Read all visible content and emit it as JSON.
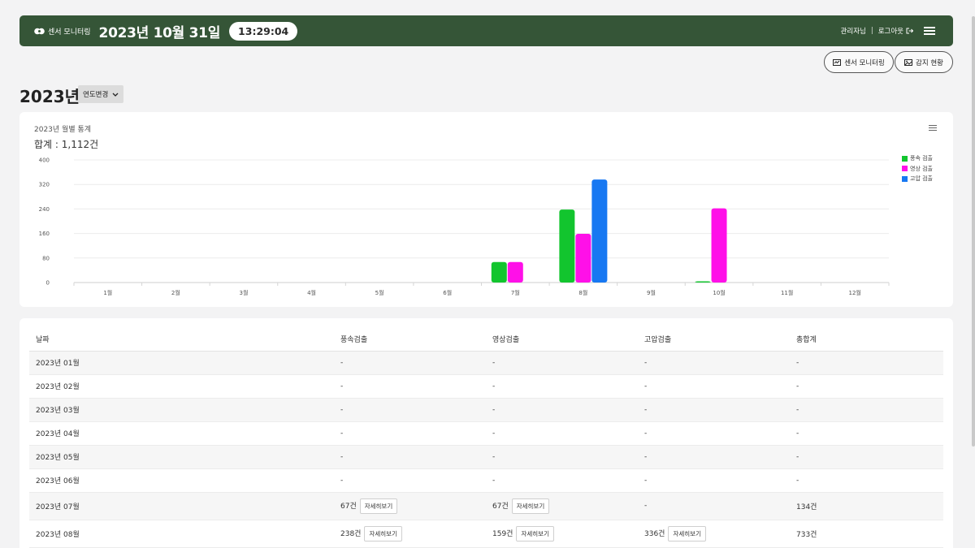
{
  "header": {
    "logo_label": "센서 모니터링",
    "date": "2023년 10월 31일",
    "time": "13:29:04",
    "user": "관리자님",
    "separator": "|",
    "logout": "로그아웃"
  },
  "nav": {
    "sensor_monitoring": "센서 모니터링",
    "detection_status": "감지 현황"
  },
  "year": {
    "title": "2023년",
    "change_label": "연도변경"
  },
  "chart_data": {
    "type": "bar",
    "title": "2023년 월별 통계",
    "total_label": "합계 : 1,112건",
    "categories": [
      "1월",
      "2월",
      "3월",
      "4월",
      "5월",
      "6월",
      "7월",
      "8월",
      "9월",
      "10월",
      "11월",
      "12월"
    ],
    "yticks": [
      "0",
      "80",
      "160",
      "240",
      "320",
      "400"
    ],
    "ylim": [
      0,
      400
    ],
    "grid": true,
    "legend_position": "top-right",
    "series": [
      {
        "name": "풍속 검출",
        "color": "#12c52e",
        "values": [
          0,
          0,
          0,
          0,
          0,
          0,
          67,
          238,
          0,
          4,
          0,
          0
        ]
      },
      {
        "name": "영상 검출",
        "color": "#ff10e8",
        "values": [
          0,
          0,
          0,
          0,
          0,
          0,
          67,
          159,
          0,
          242,
          0,
          0
        ]
      },
      {
        "name": "고압 검출",
        "color": "#1778f2",
        "values": [
          0,
          0,
          0,
          0,
          0,
          0,
          0,
          336,
          0,
          0,
          0,
          0
        ]
      }
    ]
  },
  "table": {
    "headers": [
      "날짜",
      "풍속검출",
      "영상검출",
      "고압검출",
      "총합계"
    ],
    "detail_label": "자세히보기",
    "rows": [
      {
        "date": "2023년 01월",
        "wind": "-",
        "video": "-",
        "high": "-",
        "total": "-"
      },
      {
        "date": "2023년 02월",
        "wind": "-",
        "video": "-",
        "high": "-",
        "total": "-"
      },
      {
        "date": "2023년 03월",
        "wind": "-",
        "video": "-",
        "high": "-",
        "total": "-"
      },
      {
        "date": "2023년 04월",
        "wind": "-",
        "video": "-",
        "high": "-",
        "total": "-"
      },
      {
        "date": "2023년 05월",
        "wind": "-",
        "video": "-",
        "high": "-",
        "total": "-"
      },
      {
        "date": "2023년 06월",
        "wind": "-",
        "video": "-",
        "high": "-",
        "total": "-"
      },
      {
        "date": "2023년 07월",
        "wind": "67건",
        "video": "67건",
        "high": "-",
        "total": "134건"
      },
      {
        "date": "2023년 08월",
        "wind": "238건",
        "video": "159건",
        "high": "336건",
        "total": "733건"
      }
    ]
  }
}
